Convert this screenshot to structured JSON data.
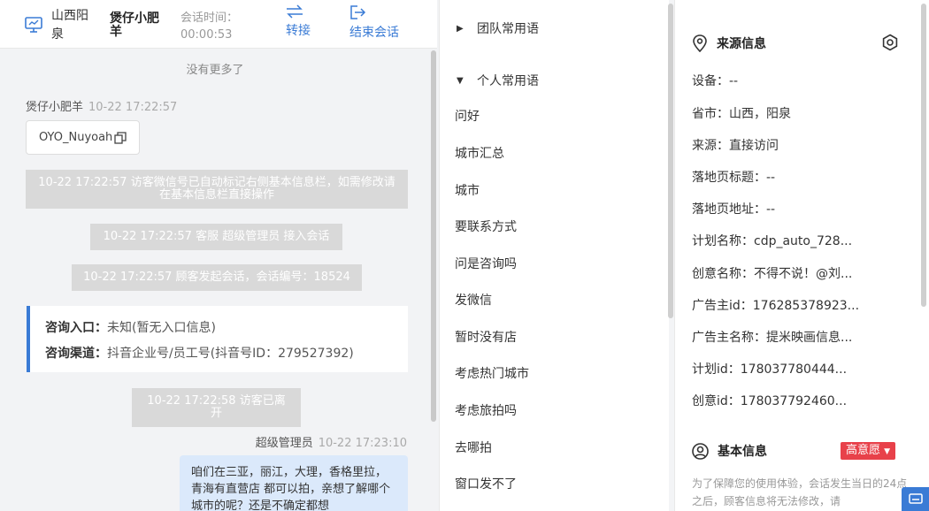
{
  "header": {
    "location": "山西阳泉",
    "customer_name": "煲仔小肥羊",
    "time_label": "会话时间：",
    "time_value": "00:00:53",
    "transfer_label": "转接",
    "end_label": "结束会话"
  },
  "chat": {
    "no_more": "没有更多了",
    "customer_sender": "煲仔小肥羊",
    "customer_time": "10-22 17:22:57",
    "copy_text": "OYO_Nuyoah",
    "sys_wechat": "10-22 17:22:57 访客微信号已自动标记右侧基本信息栏，如需修改请在基本信息栏直接操作",
    "sys_join": "10-22 17:22:57 客服 超级管理员 接入会话",
    "sys_start": "10-22 17:22:57 顾客发起会话，会话编号：18524",
    "entry_label": "咨询入口：",
    "entry_value": "未知(暂无入口信息)",
    "channel_label": "咨询渠道：",
    "channel_value": "抖音企业号/员工号(抖音号ID：279527392)",
    "sys_left": "10-22 17:22:58 访客已离开",
    "agent_sender": "超级管理员",
    "agent_time": "10-22 17:23:10",
    "agent_message": "咱们在三亚，丽江，大理，香格里拉，青海有直营店 都可以拍，亲想了解哪个城市的呢？还是不确定都想"
  },
  "phrases": {
    "team_group": "团队常用语",
    "personal_group": "个人常用语",
    "items": [
      "问好",
      "城市汇总",
      "城市",
      "要联系方式",
      "问是咨询吗",
      "发微信",
      "暂时没有店",
      "考虑热门城市",
      "考虑旅拍吗",
      "去哪拍",
      "窗口发不了"
    ]
  },
  "info": {
    "source_title": "来源信息",
    "fields": [
      "设备：--",
      "省市：山西，阳泉",
      "来源：直接访问",
      "落地页标题：--",
      "落地页地址：--",
      "计划名称：cdp_auto_728...",
      "创意名称：不得不说！@刘...",
      "广告主id：176285378923...",
      "广告主名称：提米映画信息...",
      "计划id：178037780444...",
      "创意id：178037792460..."
    ],
    "basic_title": "基本信息",
    "intent_tag": "高意愿",
    "note": "为了保障您的使用体验，会话发生当日的24点之后，顾客信息将无法修改，请"
  },
  "colors": {
    "accent": "#3a7bd5",
    "tag": "#e8414a"
  }
}
